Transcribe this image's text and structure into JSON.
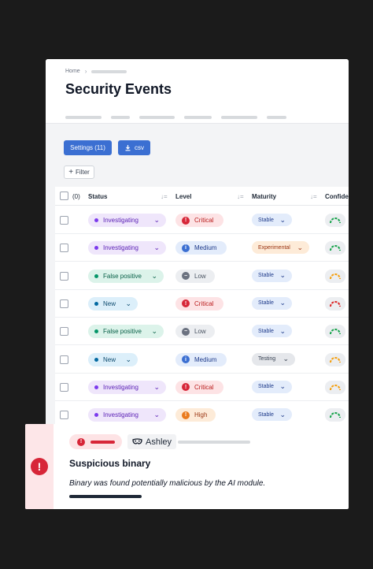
{
  "breadcrumb": {
    "home": "Home",
    "separator": "›"
  },
  "page_title": "Security Events",
  "toolbar": {
    "settings_label": "Settings (11)",
    "csv_label": "csv",
    "filter_label": "Filter",
    "filter_icon": "+"
  },
  "table": {
    "columns": {
      "selected_count": "(0)",
      "status": "Status",
      "level": "Level",
      "maturity": "Maturity",
      "confidence": "Confiden",
      "sort_icon": "↓="
    },
    "rows": [
      {
        "status": "Investigating",
        "level": "Critical",
        "maturity": "Stable",
        "confidence": "green"
      },
      {
        "status": "Investigating",
        "level": "Medium",
        "maturity": "Experimental",
        "confidence": "green"
      },
      {
        "status": "False positive",
        "level": "Low",
        "maturity": "Stable",
        "confidence": "orange"
      },
      {
        "status": "New",
        "level": "Critical",
        "maturity": "Stable",
        "confidence": "red"
      },
      {
        "status": "False positive",
        "level": "Low",
        "maturity": "Stable",
        "confidence": "green"
      },
      {
        "status": "New",
        "level": "Medium",
        "maturity": "Testing",
        "confidence": "orange"
      },
      {
        "status": "Investigating",
        "level": "Critical",
        "maturity": "Stable",
        "confidence": "orange"
      },
      {
        "status": "Investigating",
        "level": "High",
        "maturity": "Stable",
        "confidence": "green"
      }
    ]
  },
  "toast": {
    "user": "Ashley",
    "title": "Suspicious binary",
    "description": "Binary was found potentially malicious by the AI module.",
    "alert_icon": "!"
  },
  "colors": {
    "primary": "#3b6fd2",
    "critical": "#d72638",
    "status": {
      "Investigating": {
        "bg": "#efe6fb",
        "fg": "#5b21b6",
        "dot": "#7c3aed"
      },
      "False positive": {
        "bg": "#dcf3ea",
        "fg": "#065f46",
        "dot": "#059669"
      },
      "New": {
        "bg": "#dceffa",
        "fg": "#0c4a6e",
        "dot": "#0369a1"
      }
    },
    "level": {
      "Critical": {
        "bg": "#fde3e5",
        "fg": "#b91c1c",
        "icon": "#d72638",
        "glyph": "!"
      },
      "Medium": {
        "bg": "#e3ecfb",
        "fg": "#1e3a8a",
        "icon": "#3b6fd2",
        "glyph": "i"
      },
      "Low": {
        "bg": "#eceef1",
        "fg": "#4b5563",
        "icon": "#6b7280",
        "glyph": "−"
      },
      "High": {
        "bg": "#fdebd8",
        "fg": "#9a3412",
        "icon": "#ea7a1d",
        "glyph": "!"
      }
    },
    "maturity": {
      "Stable": {
        "bg": "#e3ecfb",
        "fg": "#1e3a8a"
      },
      "Experimental": {
        "bg": "#fdebd8",
        "fg": "#9a3412"
      },
      "Testing": {
        "bg": "#e5e7eb",
        "fg": "#374151"
      }
    },
    "confidence": {
      "green": "#16a34a",
      "orange": "#f59e0b",
      "red": "#dc2626"
    }
  }
}
